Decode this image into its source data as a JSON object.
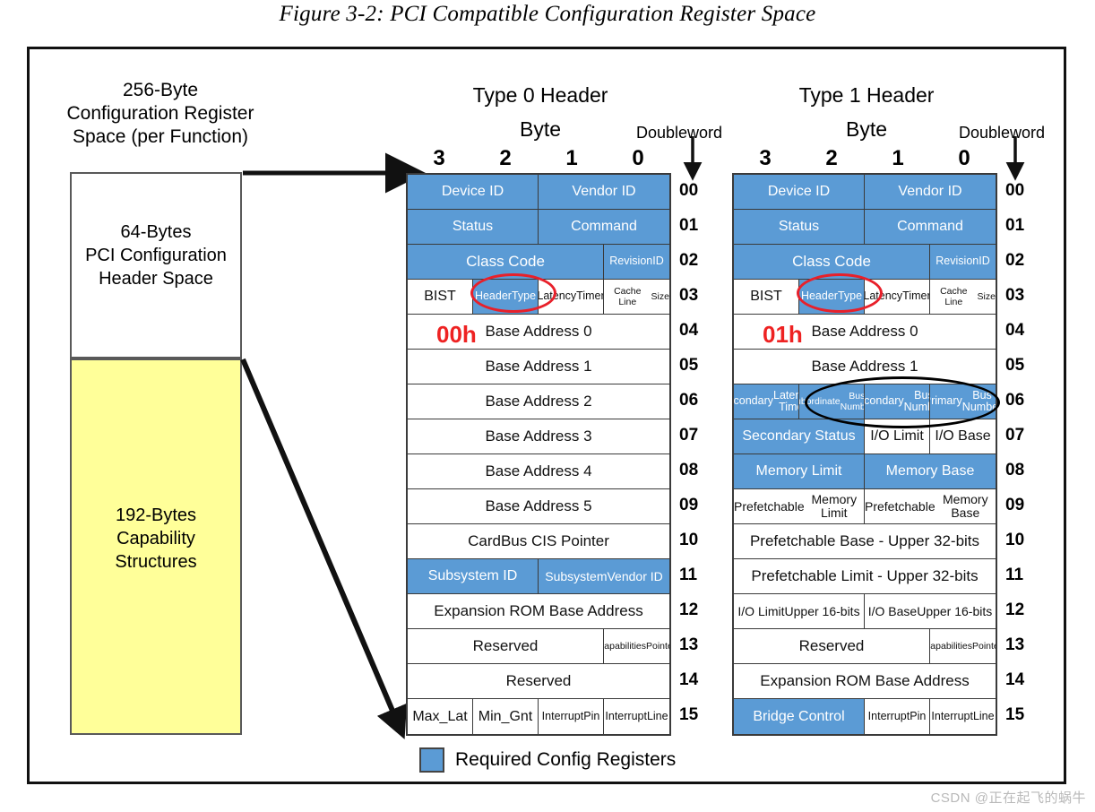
{
  "figure": {
    "title": "Figure 3-2: PCI Compatible Configuration Register Space"
  },
  "left_panel": {
    "caption": "256-Byte\nConfiguration Register\nSpace (per Function)",
    "caption_lines": [
      "256-Byte",
      "Configuration Register",
      "Space (per Function)"
    ],
    "blocks": [
      {
        "name": "header-space",
        "label": "64-Bytes\nPCI Configuration\nHeader Space",
        "color": "#ffffff"
      },
      {
        "name": "capability-structures",
        "label": "192-Bytes\nCapability\nStructures",
        "color": "#ffff99"
      }
    ],
    "header_label_lines": [
      "64-Bytes",
      "PCI Configuration",
      "Header Space"
    ],
    "capability_label_lines": [
      "192-Bytes",
      "Capability",
      "Structures"
    ]
  },
  "colors": {
    "required_blue": "#5b9bd5",
    "capability_yellow": "#ffff99",
    "highlight_red": "#e8202a",
    "border": "#3a3a3a"
  },
  "axis": {
    "byte_label": "Byte",
    "doubleword_label": "Doubleword",
    "byte_columns": [
      "3",
      "2",
      "1",
      "0"
    ]
  },
  "doubleword_numbers": [
    "00",
    "01",
    "02",
    "03",
    "04",
    "05",
    "06",
    "07",
    "08",
    "09",
    "10",
    "11",
    "12",
    "13",
    "14",
    "15"
  ],
  "type0": {
    "title": "Type 0 Header",
    "hex_marker": "00h",
    "rows": [
      {
        "dw": "00",
        "cells": [
          {
            "label": "Device ID",
            "span": 2,
            "blue": true
          },
          {
            "label": "Vendor ID",
            "span": 2,
            "blue": true
          }
        ]
      },
      {
        "dw": "01",
        "cells": [
          {
            "label": "Status",
            "span": 2,
            "blue": true
          },
          {
            "label": "Command",
            "span": 2,
            "blue": true
          }
        ]
      },
      {
        "dw": "02",
        "cells": [
          {
            "label": "Class Code",
            "span": 3,
            "blue": true
          },
          {
            "label": "Revision\nID",
            "span": 1,
            "blue": true
          }
        ]
      },
      {
        "dw": "03",
        "cells": [
          {
            "label": "BIST",
            "span": 1,
            "blue": false
          },
          {
            "label": "Header\nType",
            "span": 1,
            "blue": true
          },
          {
            "label": "Latency\nTimer",
            "span": 1,
            "blue": false
          },
          {
            "label": "Cache Line\nSize",
            "span": 1,
            "blue": false
          }
        ]
      },
      {
        "dw": "04",
        "cells": [
          {
            "label": "Base Address 0",
            "span": 4,
            "blue": false
          }
        ]
      },
      {
        "dw": "05",
        "cells": [
          {
            "label": "Base Address 1",
            "span": 4,
            "blue": false
          }
        ]
      },
      {
        "dw": "06",
        "cells": [
          {
            "label": "Base Address 2",
            "span": 4,
            "blue": false
          }
        ]
      },
      {
        "dw": "07",
        "cells": [
          {
            "label": "Base Address 3",
            "span": 4,
            "blue": false
          }
        ]
      },
      {
        "dw": "08",
        "cells": [
          {
            "label": "Base Address 4",
            "span": 4,
            "blue": false
          }
        ]
      },
      {
        "dw": "09",
        "cells": [
          {
            "label": "Base Address 5",
            "span": 4,
            "blue": false
          }
        ]
      },
      {
        "dw": "10",
        "cells": [
          {
            "label": "CardBus CIS Pointer",
            "span": 4,
            "blue": false
          }
        ]
      },
      {
        "dw": "11",
        "cells": [
          {
            "label": "Subsystem ID",
            "span": 2,
            "blue": true
          },
          {
            "label": "Subsystem\nVendor ID",
            "span": 2,
            "blue": true
          }
        ]
      },
      {
        "dw": "12",
        "cells": [
          {
            "label": "Expansion ROM Base Address",
            "span": 4,
            "blue": false
          }
        ]
      },
      {
        "dw": "13",
        "cells": [
          {
            "label": "Reserved",
            "span": 3,
            "blue": false
          },
          {
            "label": "Capabilities\nPointer",
            "span": 1,
            "blue": false
          }
        ]
      },
      {
        "dw": "14",
        "cells": [
          {
            "label": "Reserved",
            "span": 4,
            "blue": false
          }
        ]
      },
      {
        "dw": "15",
        "cells": [
          {
            "label": "Max_Lat",
            "span": 1,
            "blue": false
          },
          {
            "label": "Min_Gnt",
            "span": 1,
            "blue": false
          },
          {
            "label": "Interrupt\nPin",
            "span": 1,
            "blue": false
          },
          {
            "label": "Interrupt\nLine",
            "span": 1,
            "blue": false
          }
        ]
      }
    ]
  },
  "type1": {
    "title": "Type 1 Header",
    "hex_marker": "01h",
    "rows": [
      {
        "dw": "00",
        "cells": [
          {
            "label": "Device ID",
            "span": 2,
            "blue": true
          },
          {
            "label": "Vendor ID",
            "span": 2,
            "blue": true
          }
        ]
      },
      {
        "dw": "01",
        "cells": [
          {
            "label": "Status",
            "span": 2,
            "blue": true
          },
          {
            "label": "Command",
            "span": 2,
            "blue": true
          }
        ]
      },
      {
        "dw": "02",
        "cells": [
          {
            "label": "Class Code",
            "span": 3,
            "blue": true
          },
          {
            "label": "Revision\nID",
            "span": 1,
            "blue": true
          }
        ]
      },
      {
        "dw": "03",
        "cells": [
          {
            "label": "BIST",
            "span": 1,
            "blue": false
          },
          {
            "label": "Header\nType",
            "span": 1,
            "blue": true
          },
          {
            "label": "Latency\nTimer",
            "span": 1,
            "blue": false
          },
          {
            "label": "Cache Line\nSize",
            "span": 1,
            "blue": false
          }
        ]
      },
      {
        "dw": "04",
        "cells": [
          {
            "label": "Base Address 0",
            "span": 4,
            "blue": false
          }
        ]
      },
      {
        "dw": "05",
        "cells": [
          {
            "label": "Base Address 1",
            "span": 4,
            "blue": false
          }
        ]
      },
      {
        "dw": "06",
        "cells": [
          {
            "label": "Secondary\nLatency Timer",
            "span": 1,
            "blue": true
          },
          {
            "label": "Subordinate\nBus Number",
            "span": 1,
            "blue": true
          },
          {
            "label": "Secondary\nBus Number",
            "span": 1,
            "blue": true
          },
          {
            "label": "Primary\nBus Number",
            "span": 1,
            "blue": true
          }
        ]
      },
      {
        "dw": "07",
        "cells": [
          {
            "label": "Secondary Status",
            "span": 2,
            "blue": true
          },
          {
            "label": "I/O Limit",
            "span": 1,
            "blue": false
          },
          {
            "label": "I/O Base",
            "span": 1,
            "blue": false
          }
        ]
      },
      {
        "dw": "08",
        "cells": [
          {
            "label": "Memory Limit",
            "span": 2,
            "blue": true
          },
          {
            "label": "Memory Base",
            "span": 2,
            "blue": true
          }
        ]
      },
      {
        "dw": "09",
        "cells": [
          {
            "label": "Prefetchable\nMemory Limit",
            "span": 2,
            "blue": false
          },
          {
            "label": "Prefetchable\nMemory Base",
            "span": 2,
            "blue": false
          }
        ]
      },
      {
        "dw": "10",
        "cells": [
          {
            "label": "Prefetchable Base - Upper 32-bits",
            "span": 4,
            "blue": false
          }
        ]
      },
      {
        "dw": "11",
        "cells": [
          {
            "label": "Prefetchable Limit - Upper 32-bits",
            "span": 4,
            "blue": false
          }
        ]
      },
      {
        "dw": "12",
        "cells": [
          {
            "label": "I/O Limit\nUpper 16-bits",
            "span": 2,
            "blue": false
          },
          {
            "label": "I/O Base\nUpper 16-bits",
            "span": 2,
            "blue": false
          }
        ]
      },
      {
        "dw": "13",
        "cells": [
          {
            "label": "Reserved",
            "span": 3,
            "blue": false
          },
          {
            "label": "Capabilities\nPointer",
            "span": 1,
            "blue": false
          }
        ]
      },
      {
        "dw": "14",
        "cells": [
          {
            "label": "Expansion ROM Base Address",
            "span": 4,
            "blue": false
          }
        ]
      },
      {
        "dw": "15",
        "cells": [
          {
            "label": "Bridge Control",
            "span": 2,
            "blue": true
          },
          {
            "label": "Interrupt\nPin",
            "span": 1,
            "blue": false
          },
          {
            "label": "Interrupt\nLine",
            "span": 1,
            "blue": false
          }
        ]
      }
    ]
  },
  "annotations": {
    "header_type_circle_type0": "red-ellipse-around-header-type",
    "header_type_circle_type1": "red-ellipse-around-header-type",
    "bus_number_ellipse": "black-ellipse-around-bus-number-fields"
  },
  "legend": {
    "swatch_color": "#5b9bd5",
    "label": "Required Config Registers"
  },
  "watermark": "CSDN @正在起飞的蜗牛"
}
